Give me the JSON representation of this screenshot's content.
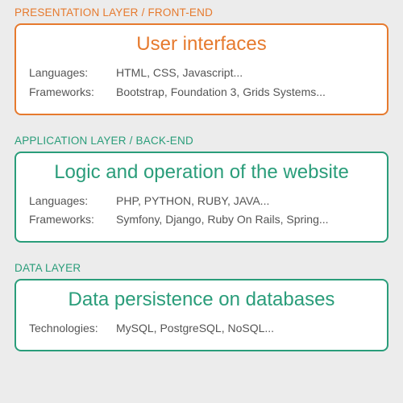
{
  "layers": [
    {
      "label": "PRESENTATION LAYER / FRONT-END",
      "title": "User interfaces",
      "rows": [
        {
          "label": "Languages:",
          "value": "HTML, CSS, Javascript..."
        },
        {
          "label": "Frameworks:",
          "value": "Bootstrap, Foundation 3, Grids Systems..."
        }
      ],
      "color": "orange"
    },
    {
      "label": "APPLICATION LAYER / BACK-END",
      "title": "Logic and operation of the website",
      "rows": [
        {
          "label": "Languages:",
          "value": "PHP, PYTHON, RUBY, JAVA..."
        },
        {
          "label": "Frameworks:",
          "value": "Symfony, Django, Ruby On Rails, Spring..."
        }
      ],
      "color": "teal"
    },
    {
      "label": "DATA LAYER",
      "title": "Data persistence on databases",
      "rows": [
        {
          "label": "Technologies:",
          "value": "MySQL, PostgreSQL, NoSQL..."
        }
      ],
      "color": "teal"
    }
  ]
}
